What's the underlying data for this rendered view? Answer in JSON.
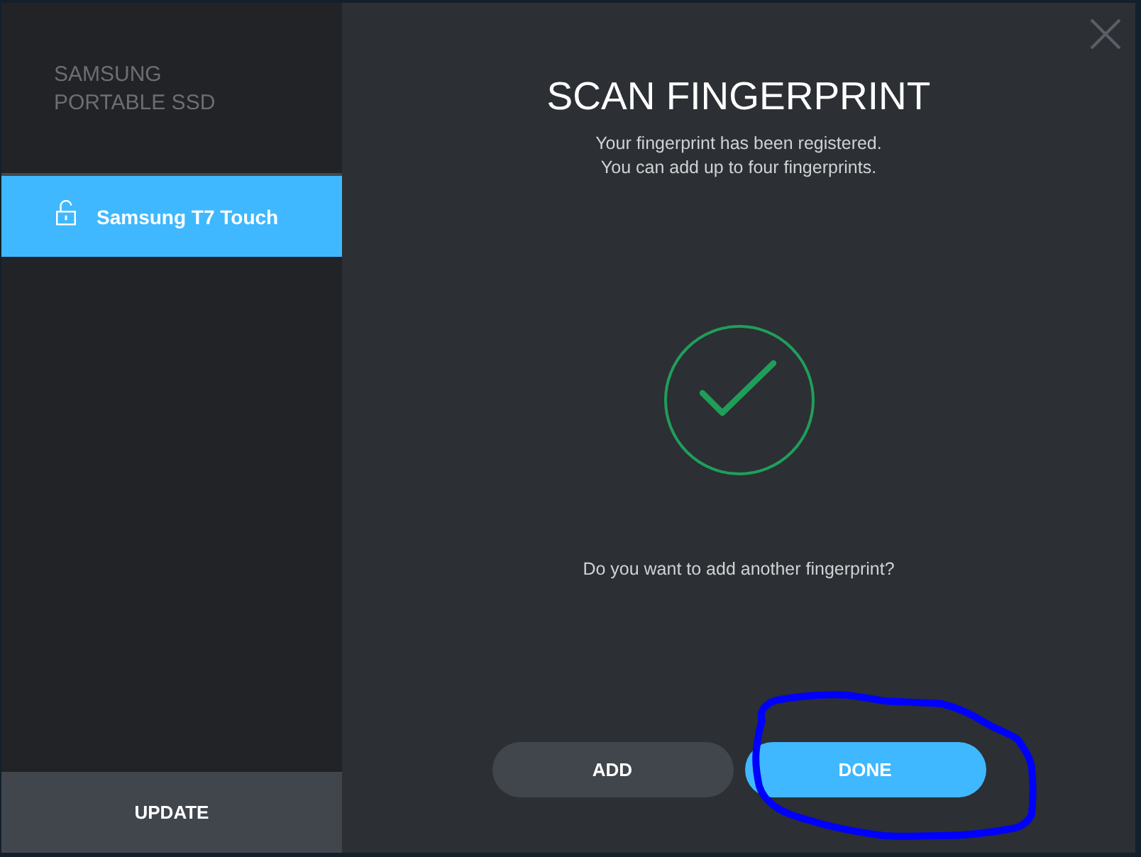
{
  "sidebar": {
    "brand_lines": [
      "SAMSUNG",
      "PORTABLE SSD"
    ],
    "items": [
      {
        "label": "Samsung T7 Touch",
        "selected": true,
        "locked": false
      }
    ],
    "update_button": "UPDATE"
  },
  "dialog": {
    "title": "SCAN FINGERPRINT",
    "messages": [
      "Your fingerprint has been registered.",
      "You can add up to four fingerprints."
    ],
    "question": "Do you want to add another fingerprint?",
    "buttons": [
      {
        "label": "ADD",
        "kind": "secondary",
        "circled": false
      },
      {
        "label": "DONE",
        "kind": "primary",
        "circled": true
      }
    ]
  }
}
